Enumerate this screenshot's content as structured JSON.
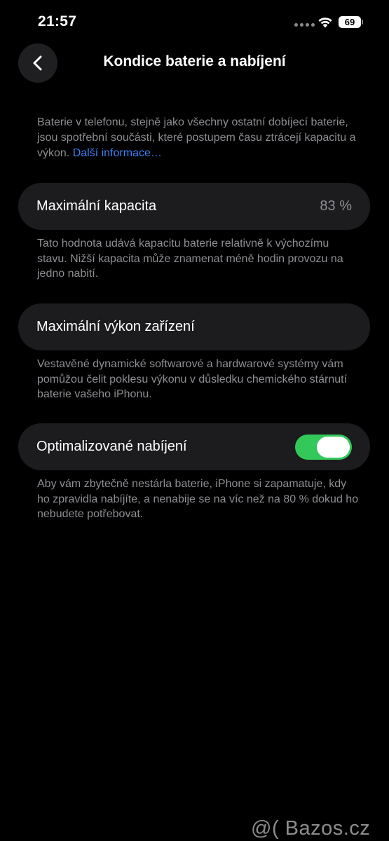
{
  "status_bar": {
    "time": "21:57",
    "battery_level": "69"
  },
  "header": {
    "title": "Kondice baterie a nabíjení",
    "back_icon": "chevron-left-icon"
  },
  "intro": {
    "text": "Baterie v telefonu, stejně jako všechny ostatní dobíjecí baterie, jsou spotřební součásti, které postupem času ztrácejí kapacitu a výkon. ",
    "link_text": "Další informace…"
  },
  "max_capacity": {
    "label": "Maximální kapacita",
    "value": "83 %",
    "note": "Tato hodnota udává kapacitu baterie relativně k výchozímu stavu. Nižší kapacita může znamenat méně hodin provozu na jedno nabití."
  },
  "peak_performance": {
    "label": "Maximální výkon zařízení",
    "note": "Vestavěné dynamické softwarové a hardwarové systémy vám pomůžou čelit poklesu výkonu v důsledku chemického stárnutí baterie vašeho iPhonu."
  },
  "optimized_charging": {
    "label": "Optimalizované nabíjení",
    "enabled": true,
    "note": "Aby vám zbytečně nestárla baterie, iPhone si zapamatuje, kdy ho zpravidla nabíjíte, a nenabije se na víc než na 80 % dokud ho nebudete potřebovat."
  },
  "colors": {
    "background": "#000000",
    "card": "#1c1c1e",
    "secondary_text": "#8e8e93",
    "link": "#3b82f6",
    "toggle_on": "#32c95a"
  },
  "watermark": {
    "text": "@( Bazos.cz"
  }
}
